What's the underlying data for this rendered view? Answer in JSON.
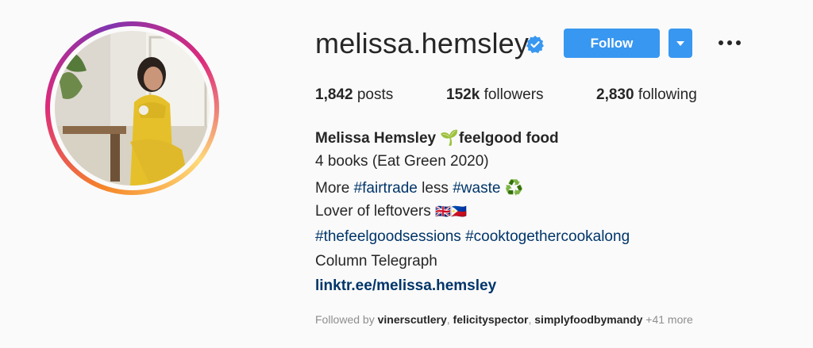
{
  "profile": {
    "username": "melissa.hemsley",
    "follow_label": "Follow",
    "stats": {
      "posts_count": "1,842",
      "posts_label": "posts",
      "followers_count": "152k",
      "followers_label": "followers",
      "following_count": "2,830",
      "following_label": "following"
    },
    "bio": {
      "name": "Melissa Hemsley",
      "name_emoji": "🌱",
      "tagline": "feelgood food",
      "line1": "4 books (Eat Green 2020)",
      "line2_prefix": "More",
      "line2_tag1": "#fairtrade",
      "line2_mid": "less",
      "line2_tag2": "#waste",
      "line2_emoji": "♻️",
      "line3": "Lover of leftovers",
      "line3_emoji": "🇬🇧🇵🇭",
      "tag_line_1": "#thefeelgoodsessions",
      "tag_line_2": "#cooktogethercookalong",
      "line5": "Column Telegraph",
      "link": "linktr.ee/melissa.hemsley"
    },
    "followed_by": {
      "prefix": "Followed by",
      "user1": "vinerscutlery",
      "user2": "felicityspector",
      "user3": "simplyfoodbymandy",
      "more": "+41 more"
    }
  },
  "icons": {
    "verified": "verified-badge-icon",
    "dropdown": "caret-down-icon",
    "more": "more-options-icon"
  },
  "colors": {
    "accent": "#3897f0",
    "link": "#003569",
    "muted": "#8e8e8e",
    "text": "#262626"
  }
}
